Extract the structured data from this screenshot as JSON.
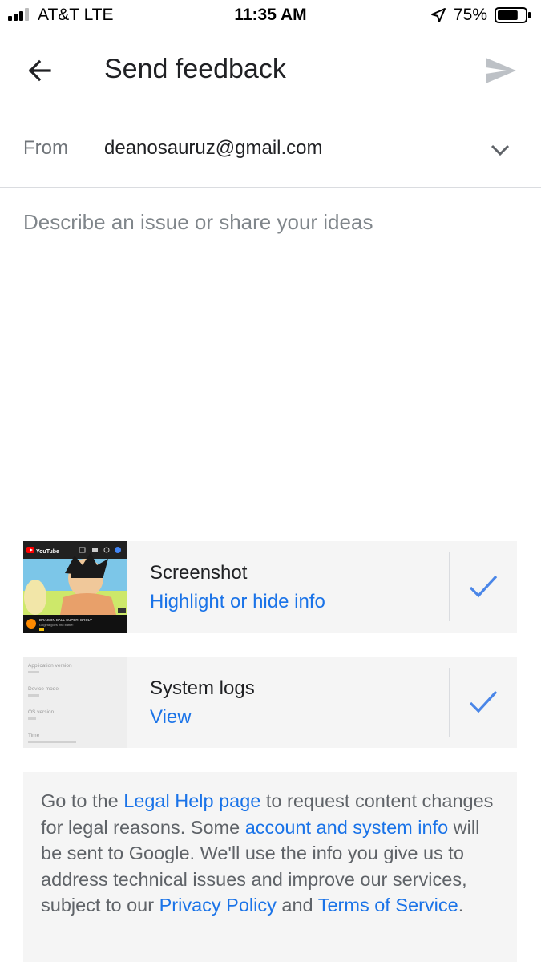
{
  "status_bar": {
    "carrier": "AT&T  LTE",
    "time": "11:35 AM",
    "battery": "75%",
    "battery_level": 0.75
  },
  "app_bar": {
    "title": "Send feedback",
    "back_icon": "arrow-left-icon",
    "send_icon": "send-icon"
  },
  "from": {
    "label": "From",
    "email": "deanosauruz@gmail.com",
    "dropdown_icon": "chevron-down-icon"
  },
  "description": {
    "placeholder": "Describe an issue or share your ideas",
    "value": ""
  },
  "attachments": {
    "screenshot": {
      "title": "Screenshot",
      "action": "Highlight or hide info",
      "checked": true,
      "thumb": {
        "app": "YouTube",
        "video_title": "DRAGON BALL SUPER: BROLY",
        "subtitle": "Gogeta goes into battle!"
      }
    },
    "system_logs": {
      "title": "System logs",
      "action": "View",
      "checked": true,
      "thumb_fields": [
        "Application version",
        "Device model",
        "OS version",
        "Time"
      ]
    }
  },
  "legal": {
    "t1": "Go to the ",
    "l1": "Legal Help page",
    "t2": " to request content changes for legal reasons. Some ",
    "l2": "account and system info",
    "t3": " will be sent to Google. We'll use the info you give us to address technical issues and improve our services, subject to our ",
    "l3": "Privacy Policy",
    "t4": " and ",
    "l4": "Terms of Service",
    "t5": "."
  },
  "colors": {
    "accent": "#1a73e8",
    "check": "#4a86e8",
    "card_bg": "#f5f5f5",
    "send_disabled": "#bdc1c6"
  }
}
